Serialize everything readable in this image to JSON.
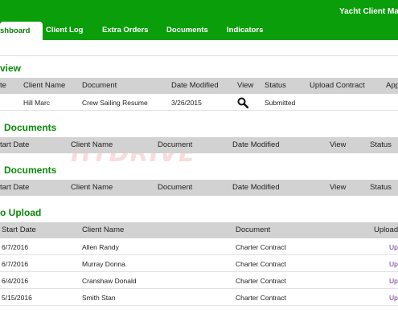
{
  "app": {
    "title": "Yacht Client Mana"
  },
  "tabs": [
    {
      "label": "shboard"
    },
    {
      "label": "Client Log"
    },
    {
      "label": "Extra Orders"
    },
    {
      "label": "Documents"
    },
    {
      "label": "Indicators"
    }
  ],
  "sections": {
    "overview": {
      "title": "view",
      "headers": [
        "te",
        "Client Name",
        "Document",
        "Date Modified",
        "View",
        "Status",
        "Upload Contract",
        "App"
      ],
      "rows": [
        {
          "client": "Hill Marc",
          "document": "Crew Sailing Resume",
          "date": "3/26/2015",
          "view_icon": "magnifier-icon",
          "status": "Submitted"
        }
      ]
    },
    "docs1": {
      "title": "Documents",
      "headers": [
        "tart Date",
        "Client Name",
        "Document",
        "Date Modified",
        "View",
        "Status"
      ]
    },
    "docs2": {
      "title": "Documents",
      "headers": [
        "tart Date",
        "Client Name",
        "Document",
        "Date Modified",
        "View",
        "Status"
      ]
    },
    "upload": {
      "title": "o Upload",
      "headers": [
        "Start Date",
        "Client Name",
        "Document",
        "Upload"
      ],
      "rows": [
        {
          "start": "6/7/2016",
          "client": "Allen Randy",
          "document": "Charter Contract",
          "action": "Up"
        },
        {
          "start": "6/7/2016",
          "client": "Murray Donna",
          "document": "Charter Contract",
          "action": "Up"
        },
        {
          "start": "6/4/2016",
          "client": "Cranshaw Donald",
          "document": "Charter Contract",
          "action": "Up"
        },
        {
          "start": "5/15/2016",
          "client": "Smith Stan",
          "document": "Charter Contract",
          "action": "Up"
        }
      ]
    }
  },
  "watermark": {
    "text": "HTDRIVE"
  },
  "colors": {
    "brand_green": "#0b9e0b",
    "link_purple": "#6a2d8f",
    "header_gray": "#d2d2d2"
  }
}
